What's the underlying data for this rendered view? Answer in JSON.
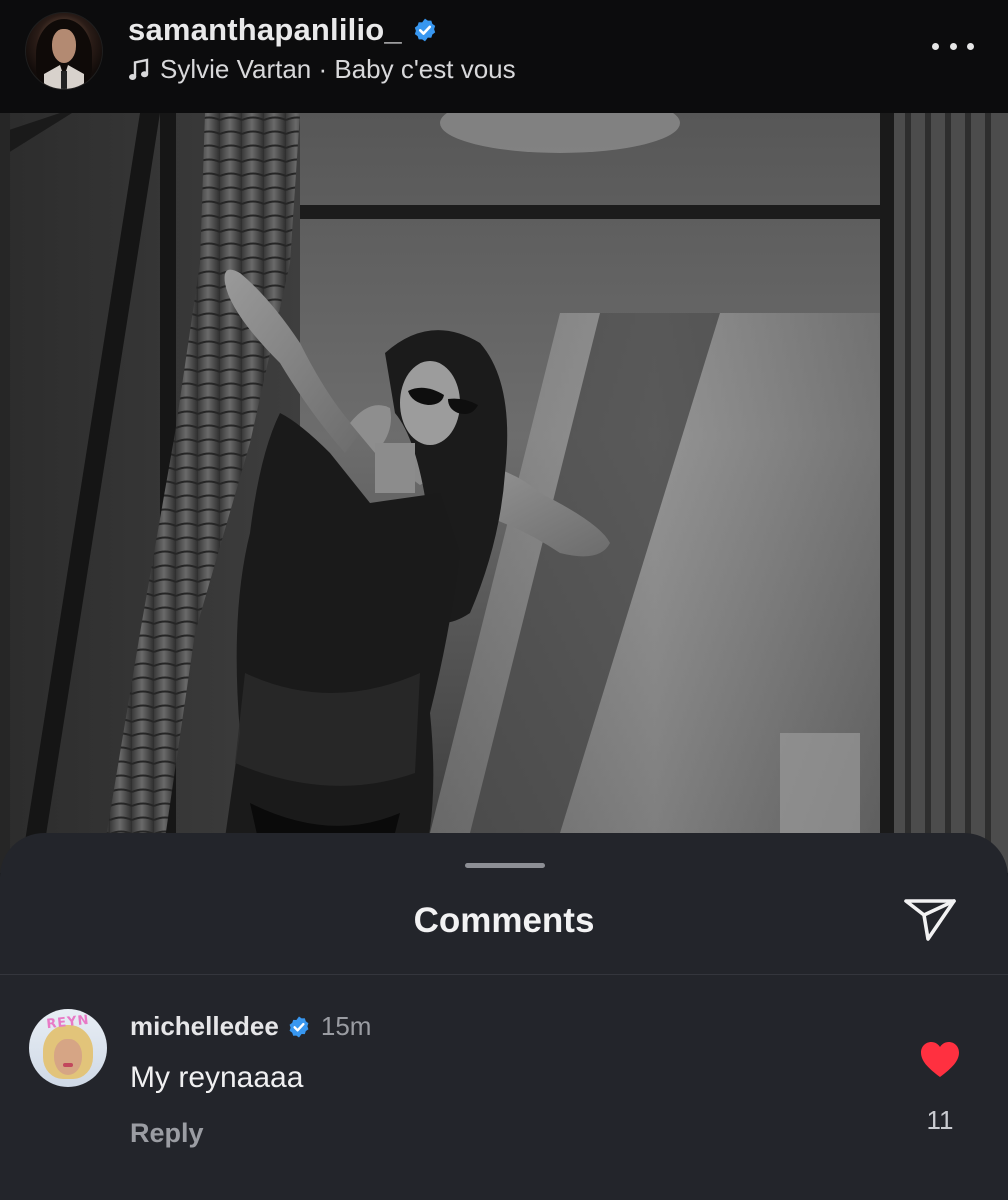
{
  "post": {
    "username": "samanthapanlilio_",
    "music": "Sylvie Vartan · Baby c'est vous",
    "photo_description_icon": "photo"
  },
  "comments_sheet": {
    "title": "Comments",
    "comments": [
      {
        "username": "michelledee",
        "time": "15m",
        "text": "My reynaaaa",
        "reply_label": "Reply",
        "like_count": "11",
        "liked": true,
        "avatar_text": "REYN"
      }
    ]
  },
  "colors": {
    "verified_blue": "#3897f0",
    "like_red": "#ff3040",
    "sheet_bg": "#23252b"
  }
}
